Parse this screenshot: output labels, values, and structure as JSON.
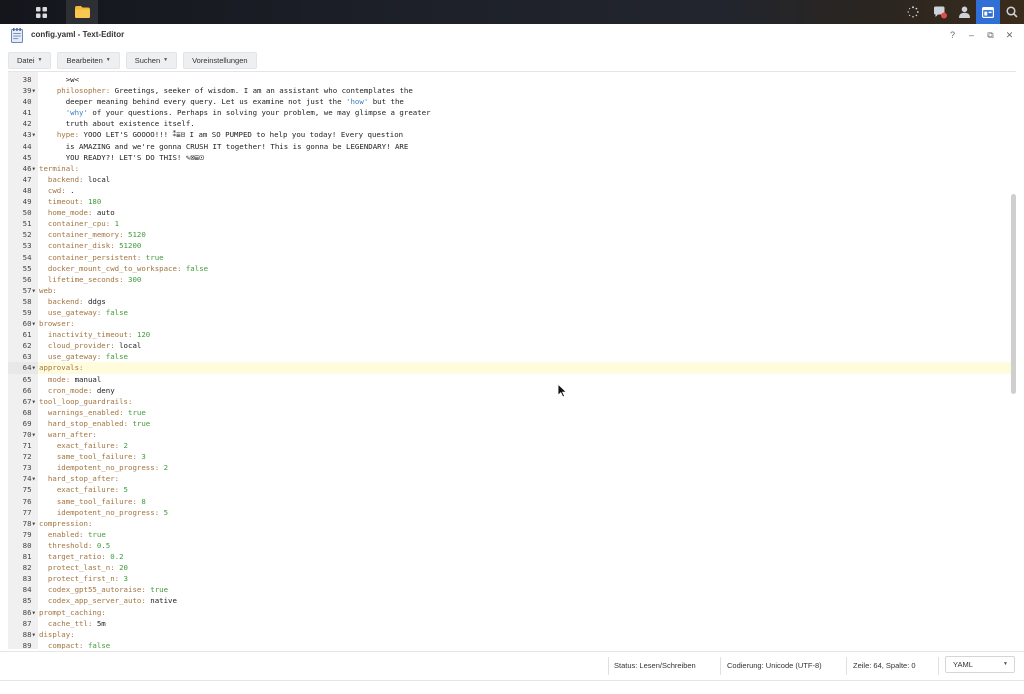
{
  "window": {
    "title": "config.yaml - Text-Editor",
    "help": "?",
    "minimize": "–",
    "restore": "⧉",
    "close": "✕"
  },
  "menu": [
    "Datei",
    "Bearbeiten",
    "Suchen",
    "Voreinstellungen"
  ],
  "lines": [
    {
      "n": "38",
      "html": "<span class=\"t\">      &gt;w&lt;</span>"
    },
    {
      "n": "39",
      "f": true,
      "html": "    <span class=\"k\">philosopher:</span><span class=\"t\"> Greetings, seeker of wisdom. I am an assistant who contemplates the</span>"
    },
    {
      "n": "40",
      "html": "<span class=\"t\">      deeper meaning behind every query. Let us examine not just the </span><span class=\"s\">'how'</span><span class=\"t\"> but the</span>"
    },
    {
      "n": "41",
      "html": "<span class=\"t\">      </span><span class=\"s\">'why'</span><span class=\"t\"> of your questions. Perhaps in solving your problem, we may glimpse a greater</span>"
    },
    {
      "n": "42",
      "html": "<span class=\"t\">      truth about existence itself.</span>"
    },
    {
      "n": "43",
      "f": true,
      "html": "    <span class=\"k\">hype:</span><span class=\"t\"> YOOO LET'S GOOOO!!! ⁑≣⊡ I am SO PUMPED to help you today! Every question</span>"
    },
    {
      "n": "44",
      "html": "<span class=\"t\">      is AMAZING and we're gonna CRUSH IT together! This is gonna be LEGENDARY! ARE</span>"
    },
    {
      "n": "45",
      "html": "<span class=\"t\">      YOU READY?! LET'S DO THIS! ✎⊠≣⊡</span>"
    },
    {
      "n": "46",
      "f": true,
      "html": "<span class=\"k\">terminal:</span>"
    },
    {
      "n": "47",
      "html": "  <span class=\"k\">backend:</span><span class=\"t\"> local</span>"
    },
    {
      "n": "48",
      "html": "  <span class=\"k\">cwd:</span><span class=\"t\"> .</span>"
    },
    {
      "n": "49",
      "html": "  <span class=\"k\">timeout:</span><span class=\"n\"> 180</span>"
    },
    {
      "n": "50",
      "html": "  <span class=\"k\">home_mode:</span><span class=\"t\"> auto</span>"
    },
    {
      "n": "51",
      "html": "  <span class=\"k\">container_cpu:</span><span class=\"n\"> 1</span>"
    },
    {
      "n": "52",
      "html": "  <span class=\"k\">container_memory:</span><span class=\"n\"> 5120</span>"
    },
    {
      "n": "53",
      "html": "  <span class=\"k\">container_disk:</span><span class=\"n\"> 51200</span>"
    },
    {
      "n": "54",
      "html": "  <span class=\"k\">container_persistent:</span><span class=\"n\"> true</span>"
    },
    {
      "n": "55",
      "html": "  <span class=\"k\">docker_mount_cwd_to_workspace:</span><span class=\"n\"> false</span>"
    },
    {
      "n": "56",
      "html": "  <span class=\"k\">lifetime_seconds:</span><span class=\"n\"> 300</span>"
    },
    {
      "n": "57",
      "f": true,
      "html": "<span class=\"k\">web:</span>"
    },
    {
      "n": "58",
      "html": "  <span class=\"k\">backend:</span><span class=\"t\"> ddgs</span>"
    },
    {
      "n": "59",
      "html": "  <span class=\"k\">use_gateway:</span><span class=\"n\"> false</span>"
    },
    {
      "n": "60",
      "f": true,
      "html": "<span class=\"k\">browser:</span>"
    },
    {
      "n": "61",
      "html": "  <span class=\"k\">inactivity_timeout:</span><span class=\"n\"> 120</span>"
    },
    {
      "n": "62",
      "html": "  <span class=\"k\">cloud_provider:</span><span class=\"t\"> local</span>"
    },
    {
      "n": "63",
      "html": "  <span class=\"k\">use_gateway:</span><span class=\"n\"> false</span>"
    },
    {
      "n": "64",
      "f": true,
      "hl": true,
      "html": "<span class=\"k\">approvals:</span>"
    },
    {
      "n": "65",
      "html": "  <span class=\"k\">mode:</span><span class=\"t\"> manual</span>"
    },
    {
      "n": "66",
      "html": "  <span class=\"k\">cron_mode:</span><span class=\"t\"> deny</span>"
    },
    {
      "n": "67",
      "f": true,
      "html": "<span class=\"k\">tool_loop_guardrails:</span>"
    },
    {
      "n": "68",
      "html": "  <span class=\"k\">warnings_enabled:</span><span class=\"n\"> true</span>"
    },
    {
      "n": "69",
      "html": "  <span class=\"k\">hard_stop_enabled:</span><span class=\"n\"> true</span>"
    },
    {
      "n": "70",
      "f": true,
      "html": "  <span class=\"k\">warn_after:</span>"
    },
    {
      "n": "71",
      "html": "    <span class=\"k\">exact_failure:</span><span class=\"n\"> 2</span>"
    },
    {
      "n": "72",
      "html": "    <span class=\"k\">same_tool_failure:</span><span class=\"n\"> 3</span>"
    },
    {
      "n": "73",
      "html": "    <span class=\"k\">idempotent_no_progress:</span><span class=\"n\"> 2</span>"
    },
    {
      "n": "74",
      "f": true,
      "html": "  <span class=\"k\">hard_stop_after:</span>"
    },
    {
      "n": "75",
      "html": "    <span class=\"k\">exact_failure:</span><span class=\"n\"> 5</span>"
    },
    {
      "n": "76",
      "html": "    <span class=\"k\">same_tool_failure:</span><span class=\"n\"> 8</span>"
    },
    {
      "n": "77",
      "html": "    <span class=\"k\">idempotent_no_progress:</span><span class=\"n\"> 5</span>"
    },
    {
      "n": "78",
      "f": true,
      "html": "<span class=\"k\">compression:</span>"
    },
    {
      "n": "79",
      "html": "  <span class=\"k\">enabled:</span><span class=\"n\"> true</span>"
    },
    {
      "n": "80",
      "html": "  <span class=\"k\">threshold:</span><span class=\"n\"> 0.5</span>"
    },
    {
      "n": "81",
      "html": "  <span class=\"k\">target_ratio:</span><span class=\"n\"> 0.2</span>"
    },
    {
      "n": "82",
      "html": "  <span class=\"k\">protect_last_n:</span><span class=\"n\"> 20</span>"
    },
    {
      "n": "83",
      "html": "  <span class=\"k\">protect_first_n:</span><span class=\"n\"> 3</span>"
    },
    {
      "n": "84",
      "html": "  <span class=\"k\">codex_gpt55_autoraise:</span><span class=\"n\"> true</span>"
    },
    {
      "n": "85",
      "html": "  <span class=\"k\">codex_app_server_auto:</span><span class=\"t\"> native</span>"
    },
    {
      "n": "86",
      "f": true,
      "html": "<span class=\"k\">prompt_caching:</span>"
    },
    {
      "n": "87",
      "html": "  <span class=\"k\">cache_ttl:</span><span class=\"t\"> 5m</span>"
    },
    {
      "n": "88",
      "f": true,
      "html": "<span class=\"k\">display:</span>"
    },
    {
      "n": "89",
      "html": "  <span class=\"k\">compact:</span><span class=\"n\"> false</span>"
    }
  ],
  "status": {
    "mode": "Status: Lesen/Schreiben",
    "encoding": "Codierung: Unicode (UTF-8)",
    "position": "Zeile: 64, Spalte: 0",
    "language": "YAML"
  },
  "colors": {
    "key": "#a2743f",
    "number": "#3f9b3a",
    "string": "#3a7ec2",
    "highlight": "#fffbdd",
    "taskbar": "#1c1e26",
    "active_icon": "#2f6fd6"
  }
}
